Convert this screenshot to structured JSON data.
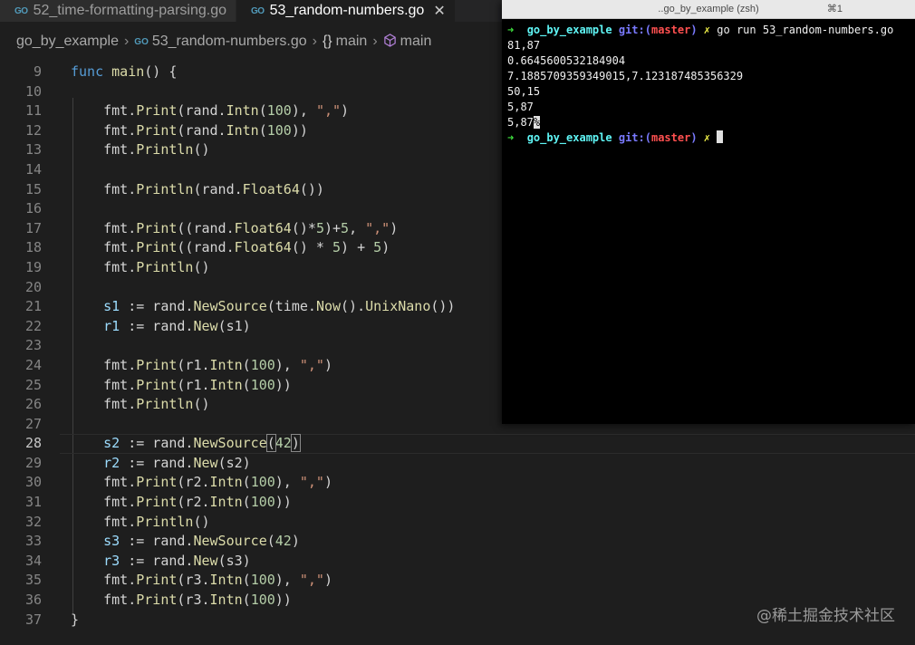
{
  "tabs": [
    {
      "icon": "go-icon",
      "label": "52_time-formatting-parsing.go",
      "active": false
    },
    {
      "icon": "go-icon",
      "label": "53_random-numbers.go",
      "active": true,
      "close": "✕"
    }
  ],
  "go_icon_text": "GO",
  "breadcrumb": {
    "folder": "go_by_example",
    "file": "53_random-numbers.go",
    "braces": "{}",
    "func1": "main",
    "func2": "main"
  },
  "code": {
    "current_line": 28,
    "lines": [
      {
        "n": 9,
        "tokens": [
          [
            "kw",
            "func "
          ],
          [
            "fn",
            "main"
          ],
          [
            "pun",
            "() {"
          ]
        ]
      },
      {
        "n": 10,
        "tokens": []
      },
      {
        "n": 11,
        "tokens": [
          [
            "pk",
            "    fmt."
          ],
          [
            "fn",
            "Print"
          ],
          [
            "pun",
            "(rand."
          ],
          [
            "fn",
            "Intn"
          ],
          [
            "pun",
            "("
          ],
          [
            "num",
            "100"
          ],
          [
            "pun",
            "), "
          ],
          [
            "str",
            "\",\""
          ],
          [
            "pun",
            ")"
          ]
        ]
      },
      {
        "n": 12,
        "tokens": [
          [
            "pk",
            "    fmt."
          ],
          [
            "fn",
            "Print"
          ],
          [
            "pun",
            "(rand."
          ],
          [
            "fn",
            "Intn"
          ],
          [
            "pun",
            "("
          ],
          [
            "num",
            "100"
          ],
          [
            "pun",
            "))"
          ]
        ]
      },
      {
        "n": 13,
        "tokens": [
          [
            "pk",
            "    fmt."
          ],
          [
            "fn",
            "Println"
          ],
          [
            "pun",
            "()"
          ]
        ]
      },
      {
        "n": 14,
        "tokens": []
      },
      {
        "n": 15,
        "tokens": [
          [
            "pk",
            "    fmt."
          ],
          [
            "fn",
            "Println"
          ],
          [
            "pun",
            "(rand."
          ],
          [
            "fn",
            "Float64"
          ],
          [
            "pun",
            "())"
          ]
        ]
      },
      {
        "n": 16,
        "tokens": []
      },
      {
        "n": 17,
        "tokens": [
          [
            "pk",
            "    fmt."
          ],
          [
            "fn",
            "Print"
          ],
          [
            "pun",
            "((rand."
          ],
          [
            "fn",
            "Float64"
          ],
          [
            "pun",
            "()*"
          ],
          [
            "num",
            "5"
          ],
          [
            "pun",
            ")+"
          ],
          [
            "num",
            "5"
          ],
          [
            "pun",
            ", "
          ],
          [
            "str",
            "\",\""
          ],
          [
            "pun",
            ")"
          ]
        ]
      },
      {
        "n": 18,
        "tokens": [
          [
            "pk",
            "    fmt."
          ],
          [
            "fn",
            "Print"
          ],
          [
            "pun",
            "((rand."
          ],
          [
            "fn",
            "Float64"
          ],
          [
            "pun",
            "() * "
          ],
          [
            "num",
            "5"
          ],
          [
            "pun",
            ") + "
          ],
          [
            "num",
            "5"
          ],
          [
            "pun",
            ")"
          ]
        ]
      },
      {
        "n": 19,
        "tokens": [
          [
            "pk",
            "    fmt."
          ],
          [
            "fn",
            "Println"
          ],
          [
            "pun",
            "()"
          ]
        ]
      },
      {
        "n": 20,
        "tokens": []
      },
      {
        "n": 21,
        "tokens": [
          [
            "var",
            "    s1"
          ],
          [
            "pun",
            " := rand."
          ],
          [
            "fn",
            "NewSource"
          ],
          [
            "pun",
            "(time."
          ],
          [
            "fn",
            "Now"
          ],
          [
            "pun",
            "()."
          ],
          [
            "fn",
            "UnixNano"
          ],
          [
            "pun",
            "())"
          ]
        ]
      },
      {
        "n": 22,
        "tokens": [
          [
            "var",
            "    r1"
          ],
          [
            "pun",
            " := rand."
          ],
          [
            "fn",
            "New"
          ],
          [
            "pun",
            "(s1)"
          ]
        ]
      },
      {
        "n": 23,
        "tokens": []
      },
      {
        "n": 24,
        "tokens": [
          [
            "pk",
            "    fmt."
          ],
          [
            "fn",
            "Print"
          ],
          [
            "pun",
            "(r1."
          ],
          [
            "fn",
            "Intn"
          ],
          [
            "pun",
            "("
          ],
          [
            "num",
            "100"
          ],
          [
            "pun",
            "), "
          ],
          [
            "str",
            "\",\""
          ],
          [
            "pun",
            ")"
          ]
        ]
      },
      {
        "n": 25,
        "tokens": [
          [
            "pk",
            "    fmt."
          ],
          [
            "fn",
            "Print"
          ],
          [
            "pun",
            "(r1."
          ],
          [
            "fn",
            "Intn"
          ],
          [
            "pun",
            "("
          ],
          [
            "num",
            "100"
          ],
          [
            "pun",
            "))"
          ]
        ]
      },
      {
        "n": 26,
        "tokens": [
          [
            "pk",
            "    fmt."
          ],
          [
            "fn",
            "Println"
          ],
          [
            "pun",
            "()"
          ]
        ]
      },
      {
        "n": 27,
        "tokens": []
      },
      {
        "n": 28,
        "tokens": [
          [
            "var",
            "    s2"
          ],
          [
            "pun",
            " := rand."
          ],
          [
            "fn",
            "NewSource"
          ],
          [
            "box",
            "("
          ],
          [
            "num",
            "42"
          ],
          [
            "box",
            ")"
          ]
        ]
      },
      {
        "n": 29,
        "tokens": [
          [
            "var",
            "    r2"
          ],
          [
            "pun",
            " := rand."
          ],
          [
            "fn",
            "New"
          ],
          [
            "pun",
            "(s2)"
          ]
        ]
      },
      {
        "n": 30,
        "tokens": [
          [
            "pk",
            "    fmt."
          ],
          [
            "fn",
            "Print"
          ],
          [
            "pun",
            "(r2."
          ],
          [
            "fn",
            "Intn"
          ],
          [
            "pun",
            "("
          ],
          [
            "num",
            "100"
          ],
          [
            "pun",
            "), "
          ],
          [
            "str",
            "\",\""
          ],
          [
            "pun",
            ")"
          ]
        ]
      },
      {
        "n": 31,
        "tokens": [
          [
            "pk",
            "    fmt."
          ],
          [
            "fn",
            "Print"
          ],
          [
            "pun",
            "(r2."
          ],
          [
            "fn",
            "Intn"
          ],
          [
            "pun",
            "("
          ],
          [
            "num",
            "100"
          ],
          [
            "pun",
            "))"
          ]
        ]
      },
      {
        "n": 32,
        "tokens": [
          [
            "pk",
            "    fmt."
          ],
          [
            "fn",
            "Println"
          ],
          [
            "pun",
            "()"
          ]
        ]
      },
      {
        "n": 33,
        "tokens": [
          [
            "var",
            "    s3"
          ],
          [
            "pun",
            " := rand."
          ],
          [
            "fn",
            "NewSource"
          ],
          [
            "pun",
            "("
          ],
          [
            "num",
            "42"
          ],
          [
            "pun",
            ")"
          ]
        ]
      },
      {
        "n": 34,
        "tokens": [
          [
            "var",
            "    r3"
          ],
          [
            "pun",
            " := rand."
          ],
          [
            "fn",
            "New"
          ],
          [
            "pun",
            "(s3)"
          ]
        ]
      },
      {
        "n": 35,
        "tokens": [
          [
            "pk",
            "    fmt."
          ],
          [
            "fn",
            "Print"
          ],
          [
            "pun",
            "(r3."
          ],
          [
            "fn",
            "Intn"
          ],
          [
            "pun",
            "("
          ],
          [
            "num",
            "100"
          ],
          [
            "pun",
            "), "
          ],
          [
            "str",
            "\",\""
          ],
          [
            "pun",
            ")"
          ]
        ]
      },
      {
        "n": 36,
        "tokens": [
          [
            "pk",
            "    fmt."
          ],
          [
            "fn",
            "Print"
          ],
          [
            "pun",
            "(r3."
          ],
          [
            "fn",
            "Intn"
          ],
          [
            "pun",
            "("
          ],
          [
            "num",
            "100"
          ],
          [
            "pun",
            "))"
          ]
        ]
      },
      {
        "n": 37,
        "tokens": [
          [
            "pun",
            "}"
          ]
        ]
      }
    ]
  },
  "terminal": {
    "title": "..go_by_example (zsh)",
    "shortcut": "⌘1",
    "prompt": {
      "arrow": "➜",
      "dir": "go_by_example",
      "git": "git:(",
      "branch": "master",
      "git_close": ")",
      "x": "✗"
    },
    "command": "go run 53_random-numbers.go",
    "output": [
      "81,87",
      "0.6645600532184904",
      "7.1885709359349015,7.123187485356329",
      "50,15",
      "5,87"
    ],
    "last_output": "5,87",
    "no_newline_mark": "%"
  },
  "watermark": "@稀土掘金技术社区"
}
